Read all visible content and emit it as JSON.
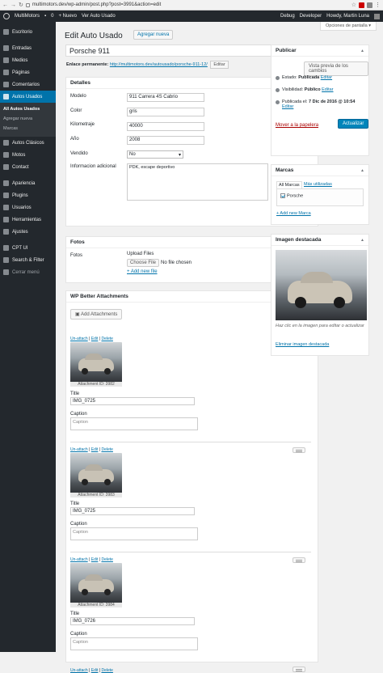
{
  "browser": {
    "url": "multimotors.dev/wp-admin/post.php?post=3991&action=edit"
  },
  "adminbar": {
    "site": "MultiMotors",
    "comments": "0",
    "new": "+ Nuevo",
    "view": "Ver Auto Usado",
    "debug": "Debug",
    "developer": "Developer",
    "howdy": "Howdy, Martin Luna"
  },
  "sidebar": {
    "items": [
      {
        "label": "Escritorio"
      },
      {
        "label": "Entradas"
      },
      {
        "label": "Medios"
      },
      {
        "label": "Páginas"
      },
      {
        "label": "Comentarios"
      },
      {
        "label": "Autos Usados"
      },
      {
        "label": "Autos Clásicos"
      },
      {
        "label": "Motos"
      },
      {
        "label": "Contact"
      },
      {
        "label": "Apariencia"
      },
      {
        "label": "Plugins"
      },
      {
        "label": "Usuarios"
      },
      {
        "label": "Herramientas"
      },
      {
        "label": "Ajustes"
      },
      {
        "label": "CPT UI"
      },
      {
        "label": "Search & Filter"
      },
      {
        "label": "Cerrar menú"
      }
    ],
    "sub": [
      "All Autos Usados",
      "Agregar nueva",
      "Marcas"
    ]
  },
  "screen_options": "Opciones de pantalla ▾",
  "page_title": "Edit Auto Usado",
  "add_new": "Agregar nueva",
  "post_title": "Porsche 911",
  "permalink": {
    "label": "Enlace permanente:",
    "url_base": "http://multimotors.dev/autousado/",
    "slug": "porsche-911-12/",
    "edit": "Editar"
  },
  "detalles": {
    "title": "Detalles",
    "fields": [
      {
        "label": "Modelo",
        "value": "911 Carrera 4S Cabrio"
      },
      {
        "label": "Color",
        "value": "gris"
      },
      {
        "label": "Kilometraje",
        "value": "40000"
      },
      {
        "label": "Año",
        "value": "2008"
      },
      {
        "label": "Vendido",
        "value": "No"
      },
      {
        "label": "Informacion adicional",
        "value": "PDK, escape deportivo"
      }
    ]
  },
  "fotos": {
    "title": "Fotos",
    "label": "Fotos",
    "upload": "Upload Files",
    "choose": "Choose File",
    "nofile": "No file chosen",
    "addnew": "+ Add new file"
  },
  "wpba": {
    "title": "WP Better Attachments",
    "add": "Add Attachments",
    "links": [
      "Un-attach",
      "Edit",
      "Delete"
    ],
    "title_label": "Title",
    "caption_label": "Caption",
    "caption_placeholder": "Caption",
    "items": [
      {
        "id": "Attachment ID: 3982",
        "title": "IMG_0725"
      },
      {
        "id": "Attachment ID: 3983",
        "title": "IMG_0725"
      },
      {
        "id": "Attachment ID: 3984",
        "title": "IMG_0726"
      }
    ]
  },
  "publicar": {
    "title": "Publicar",
    "preview": "Vista previa de los cambios",
    "estado": "Estado: ",
    "estado_val": "Publicada",
    "visibilidad": "Visibilidad: ",
    "visibilidad_val": "Público",
    "publicada": "Publicada el: ",
    "publicada_val": "7 Dic de 2016 @ 10:54",
    "edit": "Editar",
    "trash": "Mover a la papelera",
    "update": "Actualizar"
  },
  "marcas": {
    "title": "Marcas",
    "tabs": [
      "All Marcas",
      "Más utilizadas"
    ],
    "checked": "Porsche",
    "add": "+ Add new Marca"
  },
  "imagen": {
    "title": "Imagen destacada",
    "hint": "Haz clic en la imagen para editar o actualizar",
    "remove": "Eliminar imagen destacada"
  }
}
